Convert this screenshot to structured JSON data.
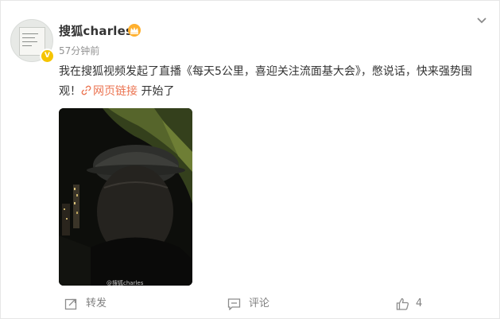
{
  "post": {
    "username": "搜狐charles",
    "timestamp": "57分钟前",
    "text_before_link": "我在搜狐视频发起了直播《每天5公里，喜迎关注流面基大会》，憋说话，快来强势围观！",
    "link_label": "网页链接",
    "text_after_link": " 开始了",
    "video_watermark": "@搜狐charles"
  },
  "actions": {
    "repost_label": "转发",
    "comment_label": "评论",
    "like_count": "4"
  },
  "icons": {
    "verified_badge": "yellow-v-badge",
    "vip": "crown-icon",
    "more": "chevron-down-icon",
    "link": "link-icon",
    "repost": "share-icon",
    "comment": "comment-icon",
    "like": "thumbs-up-icon"
  },
  "colors": {
    "link": "#eb7350",
    "text": "#333333",
    "muted": "#939393"
  }
}
